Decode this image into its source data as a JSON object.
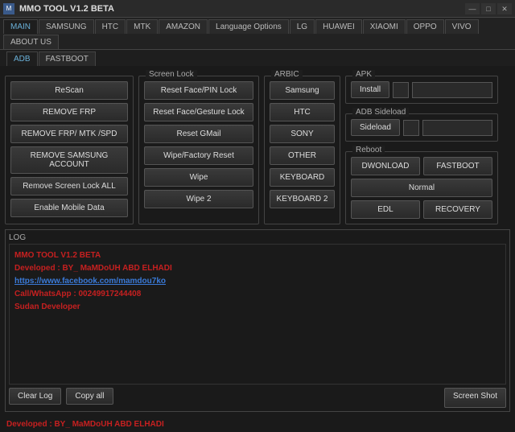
{
  "title": "MMO TOOL V1.2 BETA",
  "win_controls": {
    "min": "—",
    "max": "□",
    "close": "✕"
  },
  "tabs_outer": [
    "MAIN",
    "SAMSUNG",
    "HTC",
    "MTK",
    "AMAZON",
    "Language Options",
    "LG",
    "HUAWEI",
    "XIAOMI",
    "OPPO",
    "VIVO",
    "ABOUT US"
  ],
  "tabs_inner": [
    "ADB",
    "FASTBOOT"
  ],
  "col1": {
    "buttons": [
      "ReScan",
      "REMOVE FRP",
      "REMOVE FRP/ MTK /SPD",
      "REMOVE SAMSUNG ACCOUNT",
      "Remove Screen Lock ALL",
      "Enable Mobile Data"
    ]
  },
  "screen_lock": {
    "title": "Screen Lock",
    "buttons": [
      "Reset Face/PIN Lock",
      "Reset Face/Gesture Lock",
      "Reset GMail",
      "Wipe/Factory Reset",
      "Wipe",
      "Wipe 2"
    ]
  },
  "arbic": {
    "title": "ARBIC",
    "buttons": [
      "Samsung",
      "HTC",
      "SONY",
      "OTHER",
      "KEYBOARD",
      "KEYBOARD 2"
    ]
  },
  "apk": {
    "title": "APK",
    "install": "Install"
  },
  "adb_sideload": {
    "title": "ADB Sideload",
    "sideload": "Sideload"
  },
  "reboot": {
    "title": "Reboot",
    "download": "DWONLOAD",
    "fastboot": "FASTBOOT",
    "normal": "Normal",
    "edl": "EDL",
    "recovery": "RECOVERY"
  },
  "log": {
    "label": "LOG",
    "l1": "MMO TOOL V1.2 BETA",
    "l2": "Developed : BY_ MaMDoUH ABD ELHADI",
    "l3": "https://www.facebook.com/mamdou7ko",
    "l4": "Call/WhatsApp : 00249917244408",
    "l5": "Sudan Developer"
  },
  "bottom": {
    "clear": "Clear Log",
    "copy": "Copy all",
    "shot": "Screen Shot"
  },
  "footer": "Developed : BY_ MaMDoUH ABD ELHADI"
}
